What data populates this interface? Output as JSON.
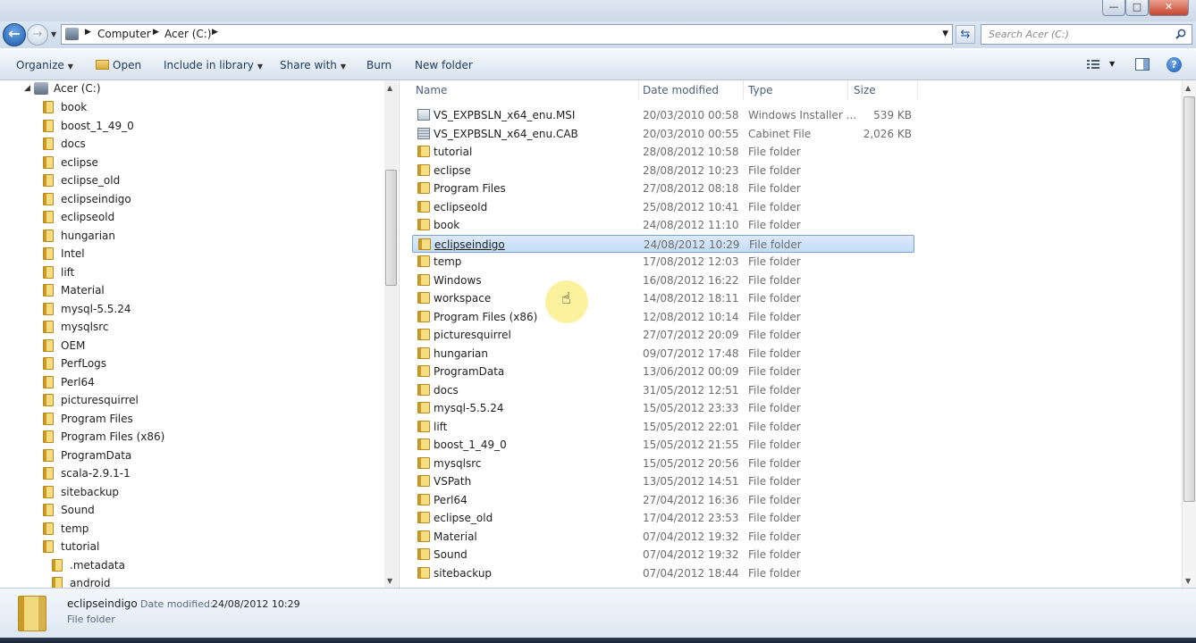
{
  "window": {
    "title": "eclipseindigo",
    "minimize_glyph": "—",
    "maximize_glyph": "□",
    "close_glyph": "✕"
  },
  "address": {
    "crumbs": [
      "Computer",
      "Acer (C:)"
    ],
    "search_placeholder": "Search Acer (C:)"
  },
  "toolbar": {
    "organize": "Organize",
    "open": "Open",
    "include_in_library": "Include in library",
    "share_with": "Share with",
    "burn": "Burn",
    "new_folder": "New folder",
    "help": "?"
  },
  "nav": {
    "root": "Acer (C:)",
    "items": [
      "book",
      "boost_1_49_0",
      "docs",
      "eclipse",
      "eclipse_old",
      "eclipseindigo",
      "eclipseold",
      "hungarian",
      "Intel",
      "lift",
      "Material",
      "mysql-5.5.24",
      "mysqlsrc",
      "OEM",
      "PerfLogs",
      "Perl64",
      "picturesquirrel",
      "Program Files",
      "Program Files (x86)",
      "ProgramData",
      "scala-2.9.1-1",
      "sitebackup",
      "Sound",
      "temp",
      "tutorial"
    ],
    "children": [
      ".metadata",
      "android"
    ]
  },
  "columns": {
    "name": "Name",
    "date": "Date modified",
    "type": "Type",
    "size": "Size"
  },
  "files": [
    {
      "name": "VS_EXPBSLN_x64_enu.MSI",
      "date": "20/03/2010 00:58",
      "type": "Windows Installer ...",
      "size": "539 KB",
      "icon": "msi-icon"
    },
    {
      "name": "VS_EXPBSLN_x64_enu.CAB",
      "date": "20/03/2010 00:55",
      "type": "Cabinet File",
      "size": "2,026 KB",
      "icon": "cab-icon"
    },
    {
      "name": "tutorial",
      "date": "28/08/2012 10:58",
      "type": "File folder",
      "size": "",
      "icon": "folder-icon"
    },
    {
      "name": "eclipse",
      "date": "28/08/2012 10:23",
      "type": "File folder",
      "size": "",
      "icon": "folder-icon"
    },
    {
      "name": "Program Files",
      "date": "27/08/2012 08:18",
      "type": "File folder",
      "size": "",
      "icon": "folder-icon"
    },
    {
      "name": "eclipseold",
      "date": "25/08/2012 10:41",
      "type": "File folder",
      "size": "",
      "icon": "folder-icon"
    },
    {
      "name": "book",
      "date": "24/08/2012 11:10",
      "type": "File folder",
      "size": "",
      "icon": "folder-icon"
    },
    {
      "name": "eclipseindigo",
      "date": "24/08/2012 10:29",
      "type": "File folder",
      "size": "",
      "icon": "folder-icon",
      "selected": true
    },
    {
      "name": "temp",
      "date": "17/08/2012 12:03",
      "type": "File folder",
      "size": "",
      "icon": "folder-icon"
    },
    {
      "name": "Windows",
      "date": "16/08/2012 16:22",
      "type": "File folder",
      "size": "",
      "icon": "folder-icon"
    },
    {
      "name": "workspace",
      "date": "14/08/2012 18:11",
      "type": "File folder",
      "size": "",
      "icon": "folder-icon"
    },
    {
      "name": "Program Files (x86)",
      "date": "12/08/2012 10:14",
      "type": "File folder",
      "size": "",
      "icon": "folder-icon"
    },
    {
      "name": "picturesquirrel",
      "date": "27/07/2012 20:09",
      "type": "File folder",
      "size": "",
      "icon": "folder-icon"
    },
    {
      "name": "hungarian",
      "date": "09/07/2012 17:48",
      "type": "File folder",
      "size": "",
      "icon": "folder-icon"
    },
    {
      "name": "ProgramData",
      "date": "13/06/2012 00:09",
      "type": "File folder",
      "size": "",
      "icon": "folder-icon"
    },
    {
      "name": "docs",
      "date": "31/05/2012 12:51",
      "type": "File folder",
      "size": "",
      "icon": "folder-icon"
    },
    {
      "name": "mysql-5.5.24",
      "date": "15/05/2012 23:33",
      "type": "File folder",
      "size": "",
      "icon": "folder-icon"
    },
    {
      "name": "lift",
      "date": "15/05/2012 22:01",
      "type": "File folder",
      "size": "",
      "icon": "folder-icon"
    },
    {
      "name": "boost_1_49_0",
      "date": "15/05/2012 21:55",
      "type": "File folder",
      "size": "",
      "icon": "folder-icon"
    },
    {
      "name": "mysqlsrc",
      "date": "15/05/2012 20:56",
      "type": "File folder",
      "size": "",
      "icon": "folder-icon"
    },
    {
      "name": "VSPath",
      "date": "13/05/2012 14:51",
      "type": "File folder",
      "size": "",
      "icon": "folder-icon"
    },
    {
      "name": "Perl64",
      "date": "27/04/2012 16:36",
      "type": "File folder",
      "size": "",
      "icon": "folder-icon"
    },
    {
      "name": "eclipse_old",
      "date": "17/04/2012 23:53",
      "type": "File folder",
      "size": "",
      "icon": "folder-icon"
    },
    {
      "name": "Material",
      "date": "07/04/2012 19:32",
      "type": "File folder",
      "size": "",
      "icon": "folder-icon"
    },
    {
      "name": "Sound",
      "date": "07/04/2012 19:32",
      "type": "File folder",
      "size": "",
      "icon": "folder-icon"
    },
    {
      "name": "sitebackup",
      "date": "07/04/2012 18:44",
      "type": "File folder",
      "size": "",
      "icon": "folder-icon"
    }
  ],
  "details": {
    "name": "eclipseindigo",
    "date_label": "Date modified:",
    "date": "24/08/2012 10:29",
    "type": "File folder"
  }
}
